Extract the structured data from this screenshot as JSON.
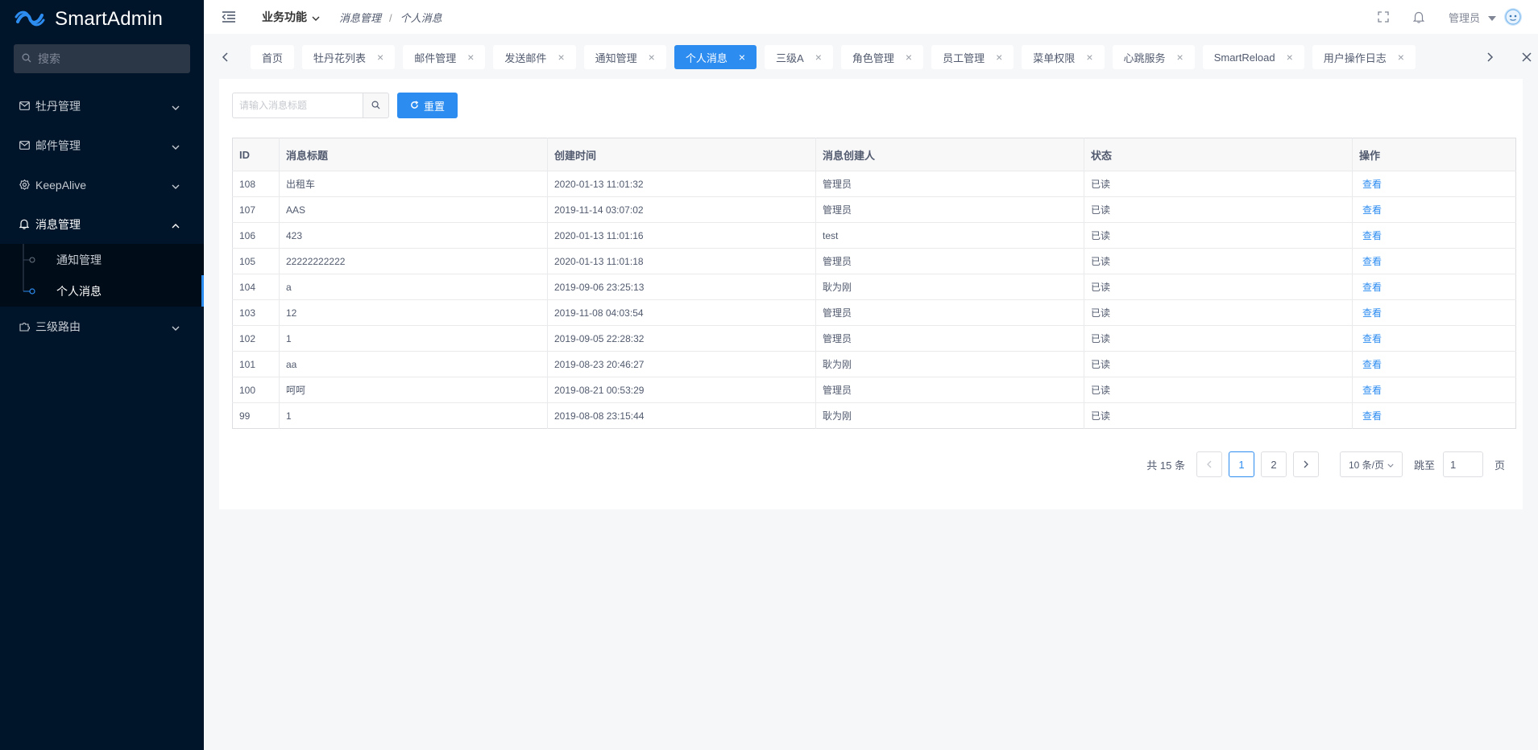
{
  "app": {
    "name": "SmartAdmin",
    "logo_icon": "smartadmin-logo-icon"
  },
  "sidebar": {
    "search_placeholder": "搜索",
    "menus": [
      {
        "label": "牡丹管理",
        "icon": "mail-icon"
      },
      {
        "label": "邮件管理",
        "icon": "mail-icon"
      },
      {
        "label": "KeepAlive",
        "icon": "gear-icon"
      },
      {
        "label": "消息管理",
        "icon": "bell-icon",
        "children": [
          "通知管理",
          "个人消息"
        ],
        "active_child": "个人消息"
      },
      {
        "label": "三级路由",
        "icon": "puzzle-icon"
      }
    ]
  },
  "header": {
    "func_label": "业务功能",
    "breadcrumb": [
      "消息管理",
      "个人消息"
    ],
    "breadcrumb_sep": "/",
    "user": "管理员"
  },
  "tabs": [
    {
      "label": "首页",
      "closable": false
    },
    {
      "label": "牡丹花列表",
      "closable": true
    },
    {
      "label": "邮件管理",
      "closable": true
    },
    {
      "label": "发送邮件",
      "closable": true
    },
    {
      "label": "通知管理",
      "closable": true
    },
    {
      "label": "个人消息",
      "closable": true,
      "active": true
    },
    {
      "label": "三级A",
      "closable": true
    },
    {
      "label": "角色管理",
      "closable": true
    },
    {
      "label": "员工管理",
      "closable": true
    },
    {
      "label": "菜单权限",
      "closable": true
    },
    {
      "label": "心跳服务",
      "closable": true
    },
    {
      "label": "SmartReload",
      "closable": true
    },
    {
      "label": "用户操作日志",
      "closable": true
    }
  ],
  "toolbar": {
    "search_placeholder": "请输入消息标题",
    "reset_label": "重置"
  },
  "table": {
    "columns": [
      "ID",
      "消息标题",
      "创建时间",
      "消息创建人",
      "状态",
      "操作"
    ],
    "rows": [
      [
        "108",
        "出租车",
        "2020-01-13 11:01:32",
        "管理员",
        "已读",
        "查看"
      ],
      [
        "107",
        "AAS",
        "2019-11-14 03:07:02",
        "管理员",
        "已读",
        "查看"
      ],
      [
        "106",
        "423",
        "2020-01-13 11:01:16",
        "test",
        "已读",
        "查看"
      ],
      [
        "105",
        "22222222222",
        "2020-01-13 11:01:18",
        "管理员",
        "已读",
        "查看"
      ],
      [
        "104",
        "a",
        "2019-09-06 23:25:13",
        "耿为刚",
        "已读",
        "查看"
      ],
      [
        "103",
        "12",
        "2019-11-08 04:03:54",
        "管理员",
        "已读",
        "查看"
      ],
      [
        "102",
        "1",
        "2019-09-05 22:28:32",
        "管理员",
        "已读",
        "查看"
      ],
      [
        "101",
        "aa",
        "2019-08-23 20:46:27",
        "耿为刚",
        "已读",
        "查看"
      ],
      [
        "100",
        "呵呵",
        "2019-08-21 00:53:29",
        "管理员",
        "已读",
        "查看"
      ],
      [
        "99",
        "1",
        "2019-08-08 23:15:44",
        "耿为刚",
        "已读",
        "查看"
      ]
    ]
  },
  "pagination": {
    "total_text": "共 15 条",
    "pages": [
      "1",
      "2"
    ],
    "current": "1",
    "page_size": "10 条/页",
    "jump_label": "跳至",
    "jump_value": "1",
    "page_suffix": "页"
  },
  "colors": {
    "primary": "#2d8cf0",
    "sidebar_bg": "#001529",
    "submenu_bg": "#000c17"
  }
}
